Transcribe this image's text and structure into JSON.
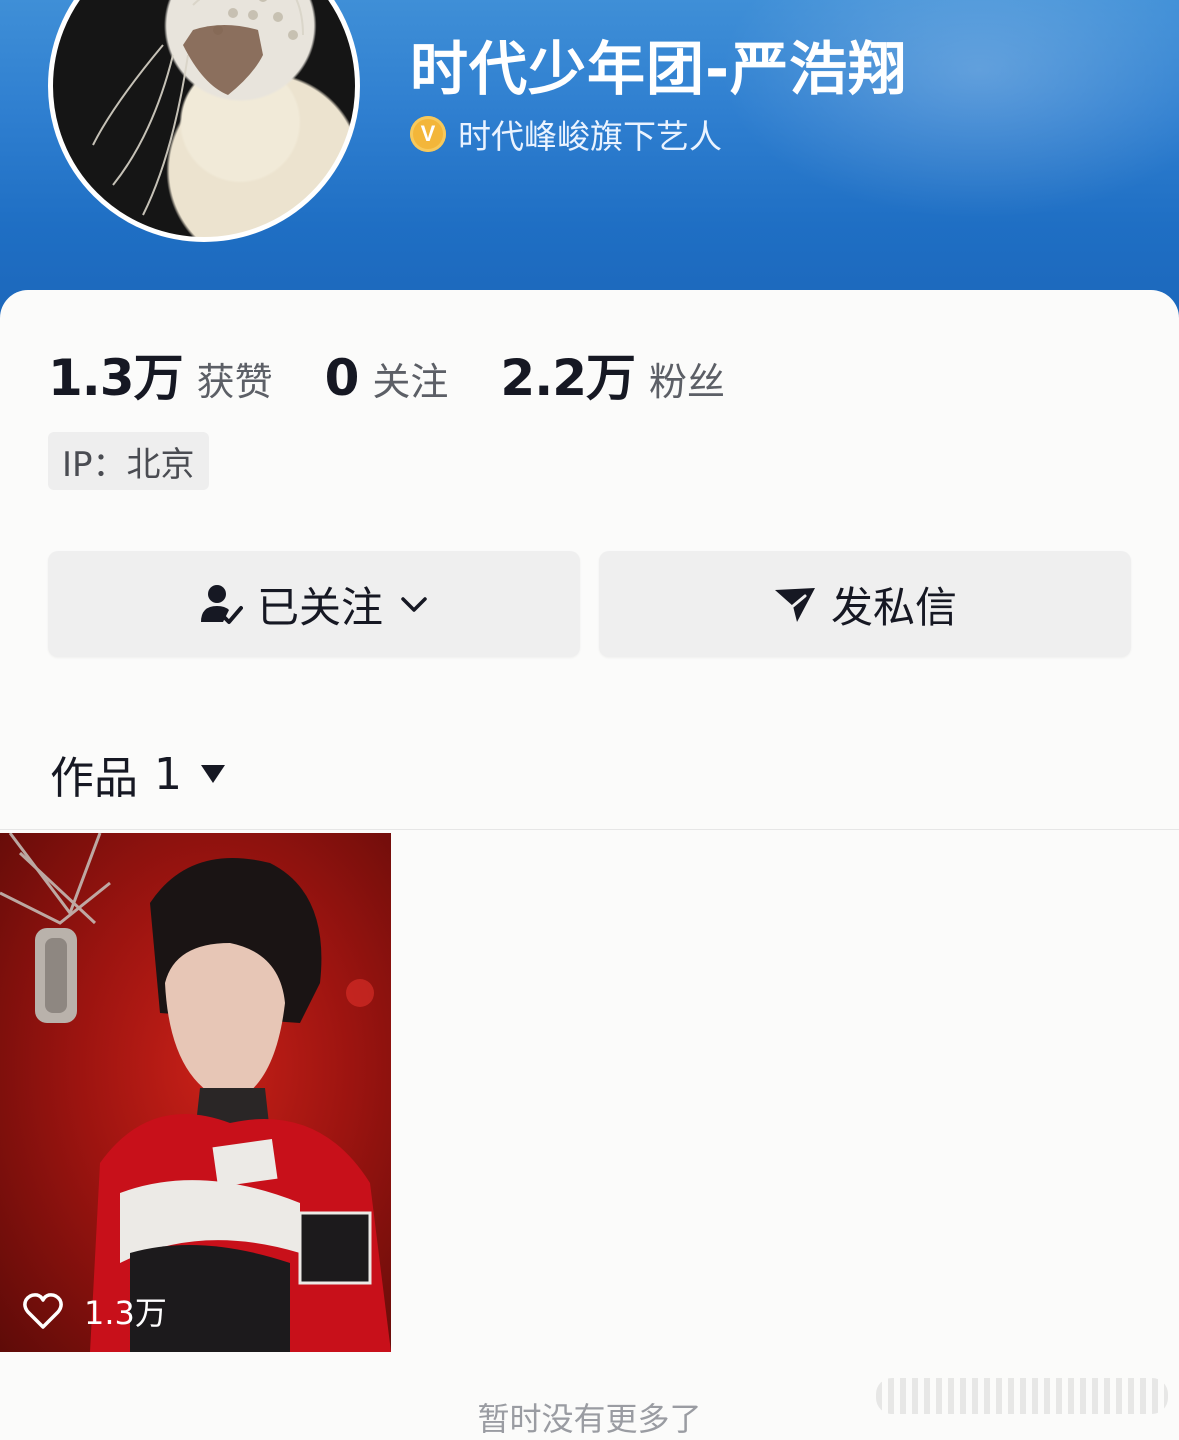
{
  "profile": {
    "name": "时代少年团-严浩翔",
    "verification": "时代峰峻旗下艺人",
    "verification_badge": "V",
    "avatar_icon": "avatar-photo"
  },
  "stats": [
    {
      "value": "1.3万",
      "label": "获赞"
    },
    {
      "value": "0",
      "label": "关注"
    },
    {
      "value": "2.2万",
      "label": "粉丝"
    }
  ],
  "ip": "IP：北京",
  "actions": {
    "follow_label": "已关注",
    "message_label": "发私信"
  },
  "works": {
    "label": "作品",
    "count": "1",
    "items": [
      {
        "likes": "1.3万"
      }
    ]
  },
  "footer": {
    "no_more": "暂时没有更多了"
  },
  "colors": {
    "header_blue": "#2f7fd0",
    "badge_gold": "#f3b63a",
    "text_dark": "#161823",
    "button_bg": "#efefef"
  }
}
